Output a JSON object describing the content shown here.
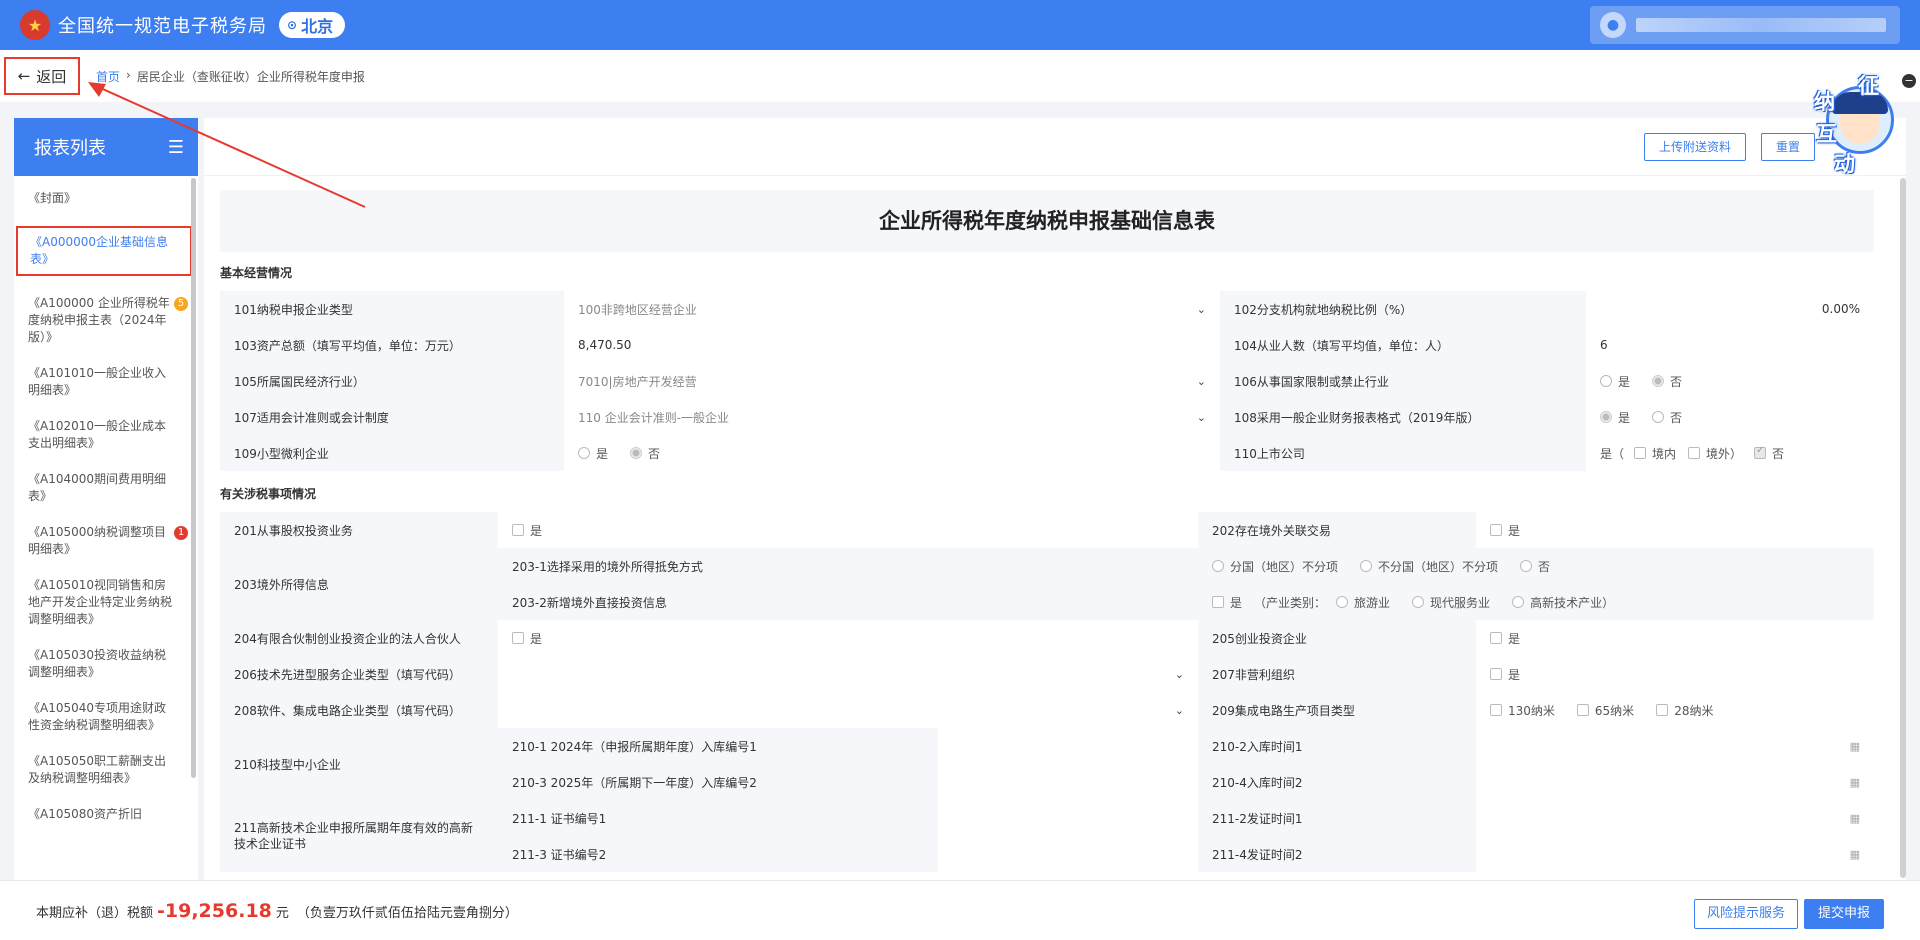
{
  "header": {
    "app_title": "全国统一规范电子税务局",
    "region": "北京",
    "logo_icon": "tax-emblem-icon"
  },
  "breadcrumb": {
    "back_label": "返回",
    "home": "首页",
    "separator": "›",
    "current": "居民企业（查账征收）企业所得税年度申报"
  },
  "sidebar": {
    "title": "报表列表",
    "items": [
      {
        "label": "《封面》"
      },
      {
        "label": "《A000000企业基础信息表》",
        "active": true
      },
      {
        "label": "《A100000 企业所得税年度纳税申报主表（2024年版）》",
        "badge": "5",
        "badge_color": "orange"
      },
      {
        "label": "《A101010一般企业收入明细表》"
      },
      {
        "label": "《A102010一般企业成本支出明细表》"
      },
      {
        "label": "《A104000期间费用明细表》"
      },
      {
        "label": "《A105000纳税调整项目明细表》",
        "badge": "1",
        "badge_color": "red"
      },
      {
        "label": "《A105010视同销售和房地产开发企业特定业务纳税调整明细表》"
      },
      {
        "label": "《A105030投资收益纳税调整明细表》"
      },
      {
        "label": "《A105040专项用途财政性资金纳税调整明细表》"
      },
      {
        "label": "《A105050职工薪酬支出及纳税调整明细表》"
      },
      {
        "label": "《A105080资产折旧"
      }
    ]
  },
  "toolbar": {
    "upload_label": "上传附送资料",
    "reset_label": "重置"
  },
  "form": {
    "title": "企业所得税年度纳税申报基础信息表",
    "section1": "基本经营情况",
    "section2": "有关涉税事项情况",
    "r101_label": "101纳税申报企业类型",
    "r101_value": "100非跨地区经营企业",
    "r102_label": "102分支机构就地纳税比例（%）",
    "r102_value": "0.00%",
    "r103_label": "103资产总额（填写平均值，单位：万元）",
    "r103_value": "8,470.50",
    "r104_label": "104从业人数（填写平均值，单位：人）",
    "r104_value": "6",
    "r105_label": "105所属国民经济行业）",
    "r105_value": "7010|房地产开发经营",
    "r106_label": "106从事国家限制或禁止行业",
    "r107_label": "107适用会计准则或会计制度",
    "r107_value": "110 企业会计准则-一般企业",
    "r108_label": "108采用一般企业财务报表格式（2019年版）",
    "r109_label": "109小型微利企业",
    "r110_label": "110上市公司",
    "yes": "是",
    "no": "否",
    "r110_open": "是（",
    "r110_domestic": "境内",
    "r110_foreign": "境外）",
    "r201_label": "201从事股权投资业务",
    "r202_label": "202存在境外关联交易",
    "r203_label": "203境外所得信息",
    "r203_1_label": "203-1选择采用的境外所得抵免方式",
    "r203_1_opt1": "分国（地区）不分项",
    "r203_1_opt2": "不分国（地区）不分项",
    "r203_2_label": "203-2新增境外直接投资信息",
    "r203_2_industry": "（产业类别：",
    "r203_2_opt1": "旅游业",
    "r203_2_opt2": "现代服务业",
    "r203_2_opt3": "高新技术产业）",
    "r204_label": "204有限合伙制创业投资企业的法人合伙人",
    "r205_label": "205创业投资企业",
    "r206_label": "206技术先进型服务企业类型（填写代码）",
    "r207_label": "207非营利组织",
    "r208_label": "208软件、集成电路企业类型（填写代码）",
    "r209_label": "209集成电路生产项目类型",
    "r209_opt1": "130纳米",
    "r209_opt2": "65纳米",
    "r209_opt3": "28纳米",
    "r210_label": "210科技型中小企业",
    "r210_1_label": "210-1  2024年（申报所属期年度）入库编号1",
    "r210_2_label": "210-2入库时间1",
    "r210_3_label": "210-3  2025年（所属期下一年度）入库编号2",
    "r210_4_label": "210-4入库时间2",
    "r211_label": "211高新技术企业申报所属期年度有效的高新技术企业证书",
    "r211_1_label": "211-1 证书编号1",
    "r211_2_label": "211-2发证时间1",
    "r211_3_label": "211-3 证书编号2",
    "r211_4_label": "211-4发证时间2"
  },
  "footer": {
    "tax_prefix": "本期应补（退）税额",
    "tax_amount": "-19,256.18",
    "tax_unit": "元",
    "tax_words": "（负壹万玖仟贰佰伍拾陆元壹角捌分）",
    "risk_label": "风险提示服务",
    "submit_label": "提交申报"
  },
  "mascot": {
    "chars": [
      "征",
      "纳",
      "互",
      "动"
    ]
  },
  "colors": {
    "brand": "#3d7ef0",
    "annotation": "#e63a2e",
    "amount": "#e63a2e"
  }
}
